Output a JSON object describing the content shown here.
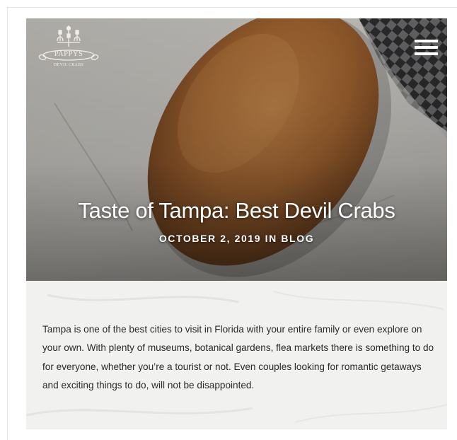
{
  "brand": {
    "logo_name": "PAPPYS",
    "logo_sub": "DEVIL CRABS"
  },
  "header": {
    "menu_icon": "hamburger-menu-icon"
  },
  "post": {
    "title": "Taste of Tampa: Best Devil Crabs",
    "meta": "OCTOBER 2, 2019 IN BLOG",
    "body": "Tampa is one of the best cities to visit in Florida with your entire family or even explore on your own. With plenty of museums, botanical gardens, flea markets there is something to do for everyone, whether you’re a tourist or not. Even couples looking for romantic getaways and exciting things to do, will not be disappointed."
  },
  "colors": {
    "hero_overlay": "#3b3633",
    "croquette": "#a86a36",
    "content_bg": "#f1f1f0",
    "text": "#2a2a2a"
  }
}
